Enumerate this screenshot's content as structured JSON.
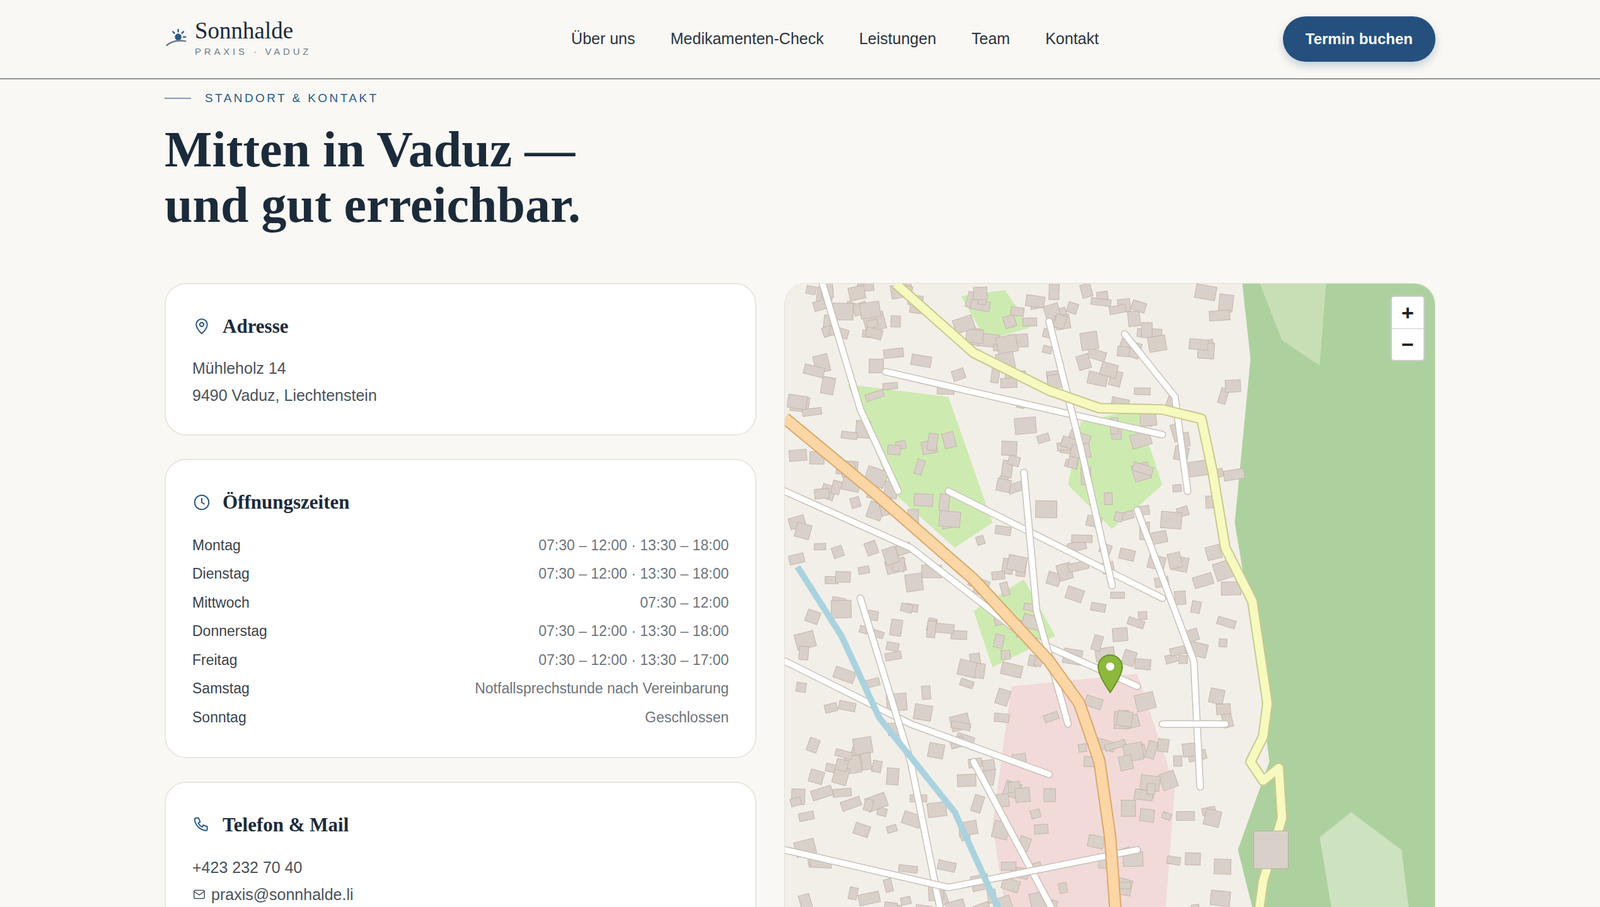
{
  "nav": {
    "logo": {
      "name": "Sonnhalde",
      "sub": "PRAXIS · VADUZ"
    },
    "links": [
      "Über uns",
      "Medikamenten-Check",
      "Leistungen",
      "Team",
      "Kontakt"
    ],
    "cta": "Termin buchen"
  },
  "section": {
    "eyebrow": "STANDORT & KONTAKT",
    "title_lines": [
      "Mitten in Vaduz —",
      "und gut erreichbar."
    ]
  },
  "address": {
    "title": "Adresse",
    "lines": [
      "Mühleholz 14",
      "9490 Vaduz, Liechtenstein"
    ]
  },
  "hours": {
    "title": "Öffnungszeiten",
    "rows": [
      {
        "day": "Montag",
        "time": "07:30 – 12:00 · 13:30 – 18:00"
      },
      {
        "day": "Dienstag",
        "time": "07:30 – 12:00 · 13:30 – 18:00"
      },
      {
        "day": "Mittwoch",
        "time": "07:30 – 12:00"
      },
      {
        "day": "Donnerstag",
        "time": "07:30 – 12:00 · 13:30 – 18:00"
      },
      {
        "day": "Freitag",
        "time": "07:30 – 12:00 · 13:30 – 17:00"
      },
      {
        "day": "Samstag",
        "time": "Notfallsprechstunde nach Vereinbarung"
      },
      {
        "day": "Sonntag",
        "time": "Geschlossen"
      }
    ]
  },
  "contact": {
    "title": "Telefon & Mail",
    "phone": "+423 232 70 40",
    "mail": "praxis@sonnhalde.li"
  },
  "map": {
    "zoom_in": "+",
    "zoom_out": "−"
  }
}
